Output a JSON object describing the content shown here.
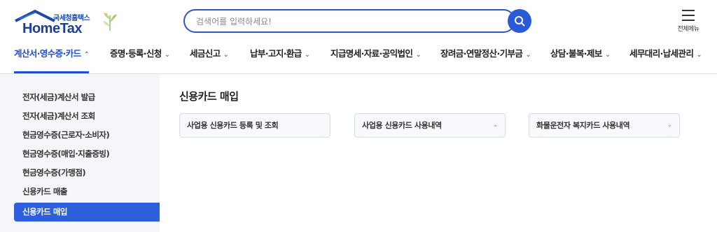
{
  "logo": {
    "sub_text": "국세청홈택스",
    "main_text": "HomeTax"
  },
  "search": {
    "placeholder": "검색어를 입력하세요!"
  },
  "header": {
    "all_menu_label": "전체메뉴"
  },
  "gnb": {
    "items": [
      {
        "label": "계산서·영수증·카드",
        "expanded": true
      },
      {
        "label": "증명·등록·신청"
      },
      {
        "label": "세금신고"
      },
      {
        "label": "납부·고지·환급"
      },
      {
        "label": "지급명세·자료·공익법인"
      },
      {
        "label": "장려금·연말정산·기부금"
      },
      {
        "label": "상담·불복·제보"
      },
      {
        "label": "세무대리·납세관리"
      }
    ]
  },
  "lnb": {
    "items": [
      {
        "label": "전자(세금)계산서 발급"
      },
      {
        "label": "전자(세금)계산서 조회"
      },
      {
        "label": "현금영수증(근로자·소비자)"
      },
      {
        "label": "현금영수증(매입·지출증빙)"
      },
      {
        "label": "현금영수증(가맹점)"
      },
      {
        "label": "신용카드 매출"
      },
      {
        "label": "신용카드 매입",
        "active": true
      }
    ]
  },
  "content": {
    "title": "신용카드 매입",
    "sub_buttons": [
      {
        "label": "사업용 신용카드 등록 및 조회"
      },
      {
        "label": "사업용 신용카드 사용내역"
      },
      {
        "label": "화물운전자 복지카드 사용내역"
      }
    ]
  },
  "colors": {
    "accent": "#1e4fc9",
    "active_bg": "#2d5fdc",
    "sidebar_bg": "#f4f6f9"
  }
}
